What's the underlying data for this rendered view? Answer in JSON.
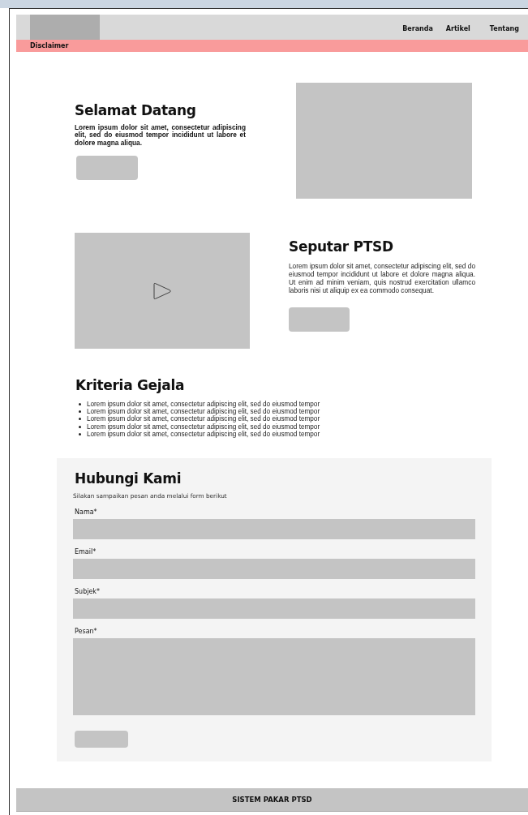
{
  "nav": {
    "items": [
      "Beranda",
      "Artikel",
      "Tentang"
    ]
  },
  "disclaimer": "Disclaimer",
  "hero": {
    "title": "Selamat Datang",
    "text": "Lorem ipsum dolor sit amet, consectetur adipiscing elit, sed do eiusmod tempor incididunt ut labore et dolore magna aliqua."
  },
  "about": {
    "title": "Seputar PTSD",
    "text": "Lorem ipsum dolor sit amet, consectetur adipiscing elit, sed do eiusmod tempor incididunt ut labore et dolore magna aliqua. Ut enim ad minim veniam, quis nostrud exercitation ullamco laboris nisi ut aliquip ex ea commodo consequat."
  },
  "criteria": {
    "title": "Kriteria Gejala",
    "items": [
      "Lorem ipsum dolor sit amet, consectetur adipiscing elit, sed do eiusmod tempor",
      "Lorem ipsum dolor sit amet, consectetur adipiscing elit, sed do eiusmod tempor",
      "Lorem ipsum dolor sit amet, consectetur adipiscing elit, sed do eiusmod tempor",
      "Lorem ipsum dolor sit amet, consectetur adipiscing elit, sed do eiusmod tempor",
      "Lorem ipsum dolor sit amet, consectetur adipiscing elit, sed do eiusmod tempor"
    ]
  },
  "contact": {
    "title": "Hubungi Kami",
    "subtitle": "Silakan sampaikan pesan anda melalui form berikut",
    "fields": [
      {
        "label": "Nama*",
        "kind": "text"
      },
      {
        "label": "Email*",
        "kind": "text"
      },
      {
        "label": "Subjek*",
        "kind": "text"
      },
      {
        "label": "Pesan*",
        "kind": "textarea"
      }
    ]
  },
  "footer": "SISTEM PAKAR PTSD"
}
